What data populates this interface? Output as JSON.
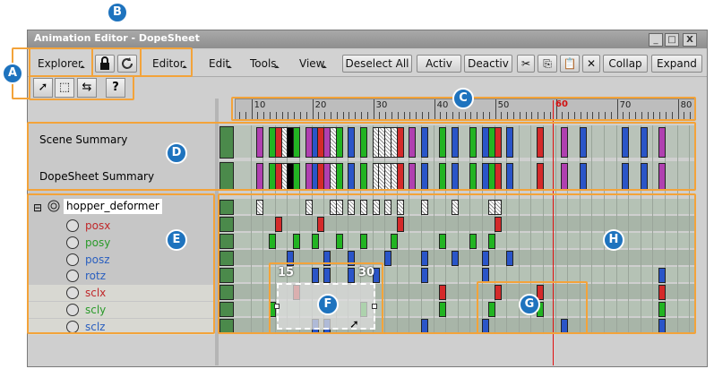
{
  "window": {
    "title": "Animation Editor - DopeSheet",
    "min_label": "_",
    "max_label": "□",
    "close_label": "X"
  },
  "toolbar": {
    "explorer_label": "Explorer",
    "editor_label": "Editor",
    "menus": [
      "Edit",
      "Tools",
      "View"
    ],
    "deselect_all_label": "Deselect All",
    "activ_label": "Activ",
    "deactiv_label": "Deactiv",
    "collap_label": "Collap",
    "expand_label": "Expand"
  },
  "tools": {
    "help_label": "?"
  },
  "timeline": {
    "ticks": [
      10,
      20,
      30,
      40,
      50,
      60,
      70,
      80
    ],
    "current_frame_label": "60",
    "current_frame": 60
  },
  "summary": {
    "scene_label": "Scene Summary",
    "dopesheet_label": "DopeSheet Summary"
  },
  "tree": {
    "root_label": "hopper_deformer",
    "expand_label": "⊟",
    "params": [
      {
        "label": "posx",
        "color": "#c0282a"
      },
      {
        "label": "posy",
        "color": "#2a9a2a"
      },
      {
        "label": "posz",
        "color": "#2a5fbf"
      },
      {
        "label": "rotz",
        "color": "#2a5fbf"
      },
      {
        "label": "sclx",
        "color": "#c0282a"
      },
      {
        "label": "scly",
        "color": "#2a9a2a"
      },
      {
        "label": "sclz",
        "color": "#2a5fbf"
      }
    ]
  },
  "selection_region": {
    "start_label": "15",
    "end_label": "30"
  },
  "callouts": [
    "A",
    "B",
    "C",
    "D",
    "E",
    "F",
    "G",
    "H"
  ],
  "colors": {
    "accent": "#f3a33a",
    "callout": "#1e73be",
    "playhead": "#e01010"
  }
}
